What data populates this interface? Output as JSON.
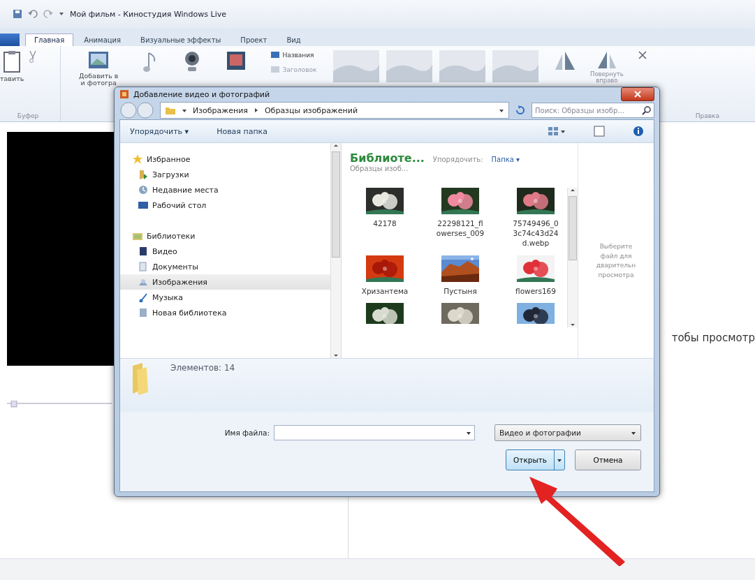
{
  "window": {
    "title": "Мой фильм - Киностудия Windows Live"
  },
  "tabs": [
    {
      "label": "Главная",
      "selected": true
    },
    {
      "label": "Анимация",
      "selected": false
    },
    {
      "label": "Визуальные эффекты",
      "selected": false
    },
    {
      "label": "Проект",
      "selected": false
    },
    {
      "label": "Вид",
      "selected": false
    }
  ],
  "ribbon": {
    "paste_label": "тавить",
    "clipboard_group": "Буфер",
    "add_label": [
      "Добавить в",
      "и фотогра"
    ],
    "title_items": [
      "Названия",
      "Заголовок"
    ],
    "rotate_label": [
      "Повернуть",
      "вправо"
    ],
    "edit_group": "Правка"
  },
  "storyboard": {
    "hint": "тобы просмотр"
  },
  "dialog": {
    "title": "Добавление видео и фотографий",
    "breadcrumb": [
      "Изображения",
      "Образцы изображений"
    ],
    "search": {
      "placeholder": "Поиск: Образцы изобр..."
    },
    "toolbar": [
      "Упорядочить ▾",
      "Новая папка"
    ],
    "nav": [
      {
        "label": "Избранное",
        "selected": false,
        "children": [
          {
            "label": "Загрузки",
            "selected": false
          },
          {
            "label": "Недавние места",
            "selected": false
          },
          {
            "label": "Рабочий стол",
            "selected": false
          }
        ]
      },
      {
        "label": "Библиотеки",
        "selected": false,
        "children": [
          {
            "label": "Видео",
            "selected": false
          },
          {
            "label": "Документы",
            "selected": false
          },
          {
            "label": "Изображения",
            "selected": true
          },
          {
            "label": "Музыка",
            "selected": false
          },
          {
            "label": "Новая библиотека",
            "selected": false
          }
        ]
      }
    ],
    "library": {
      "title": "Библиоте...",
      "subtitle": "Образцы изоб...",
      "arrange_label": "Упорядочить:",
      "arrange_value": "Папка ▾"
    },
    "files": [
      {
        "kind": "file",
        "name": "42178"
      },
      {
        "kind": "file",
        "name": "22298121_flowerses_009"
      },
      {
        "kind": "file",
        "name": "75749496_03c74c43d24d.webp"
      },
      {
        "kind": "file",
        "name": "Хризантема"
      },
      {
        "kind": "file",
        "name": "Пустыня"
      },
      {
        "kind": "file",
        "name": "flowers169"
      },
      {
        "kind": "picture"
      },
      {
        "kind": "picture"
      },
      {
        "kind": "picture"
      }
    ],
    "preview_hint": "Выберите файл для дварительн просмотра",
    "details": "Элементов: 14",
    "filename_label": "Имя файла:",
    "filter": "Видео и фотографии",
    "buttons": [
      "Открыть",
      "Отмена"
    ]
  }
}
